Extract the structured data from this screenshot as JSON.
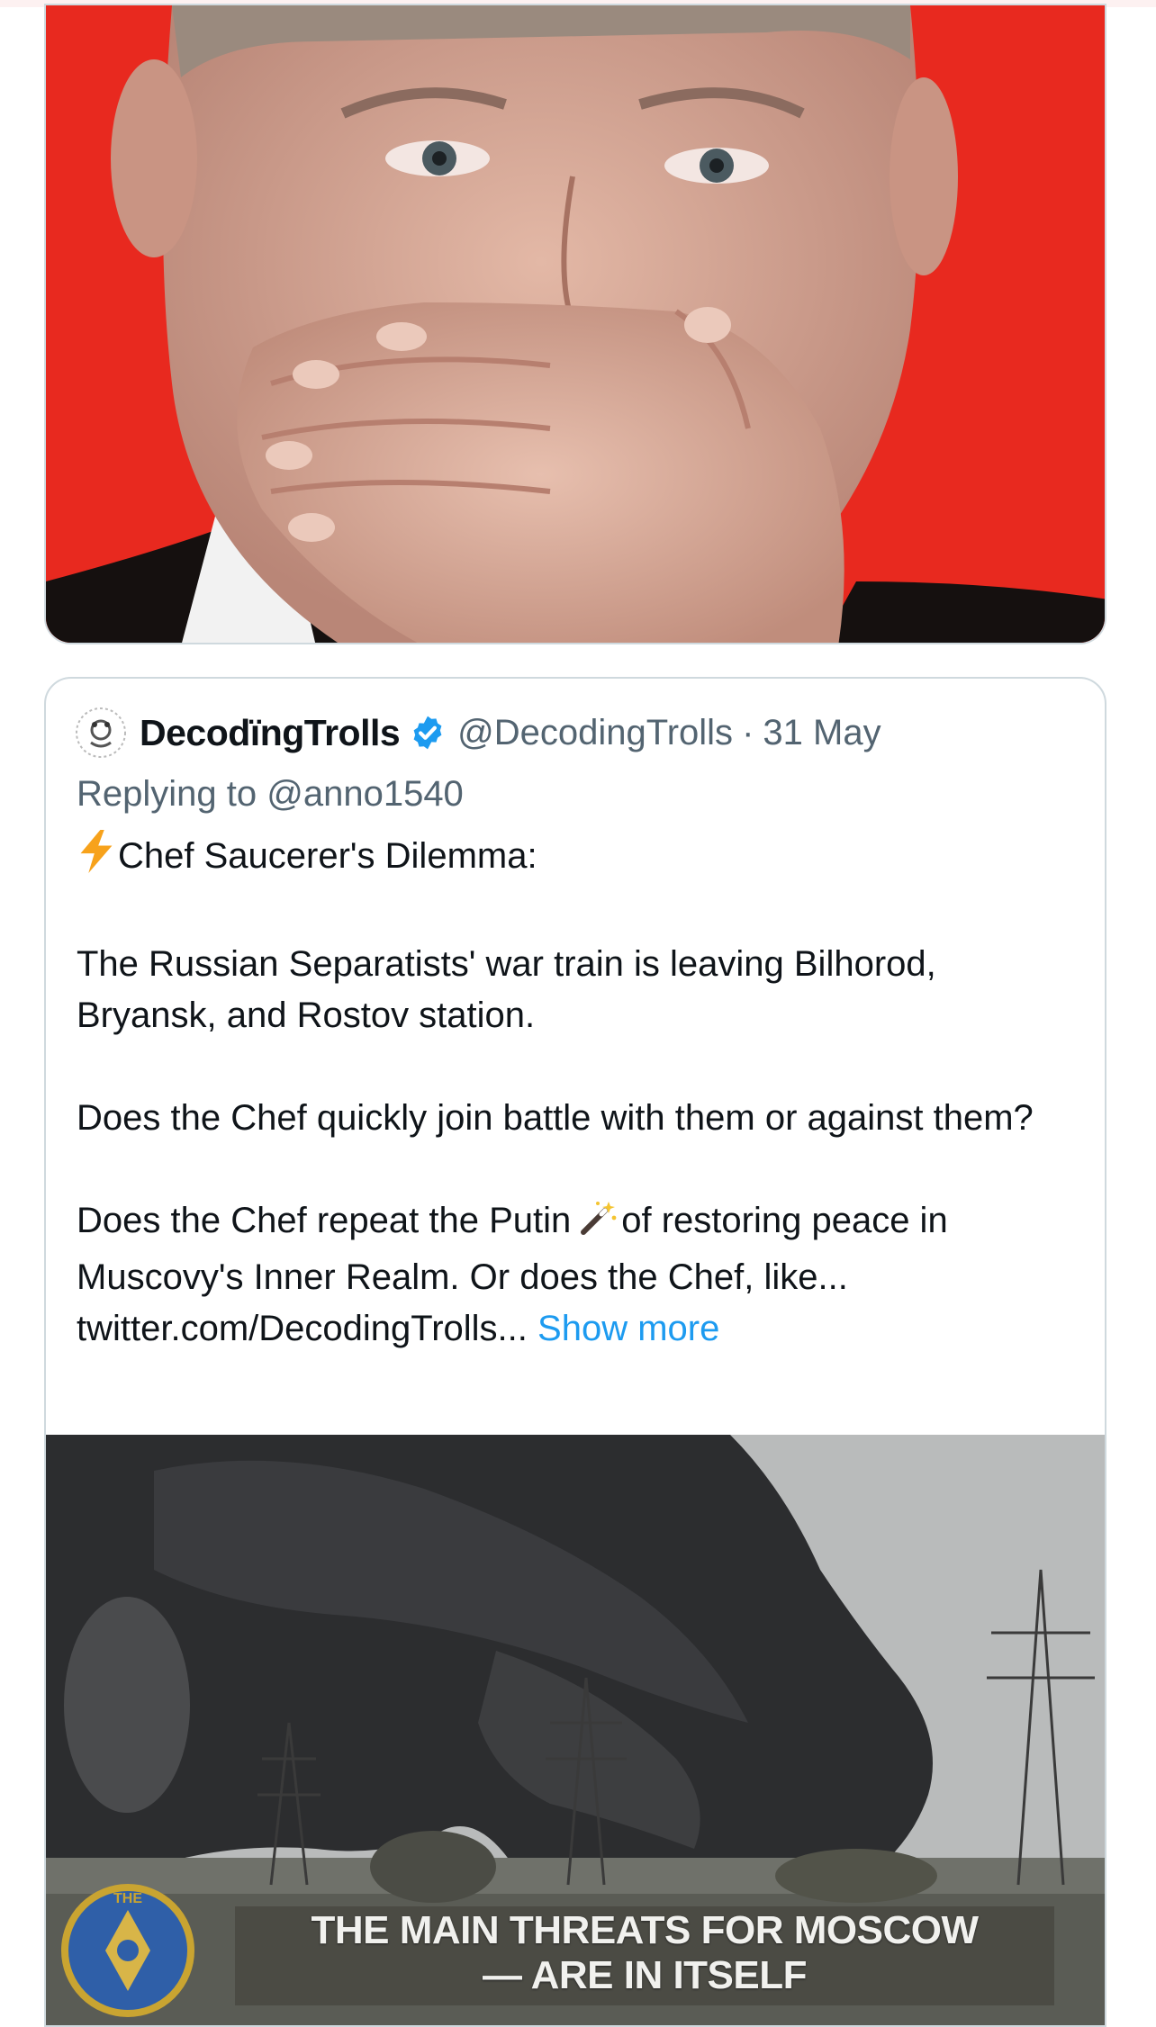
{
  "quoted_tweet": {
    "display_name": "DecodïngTrolls",
    "handle": "@DecodingTrolls",
    "separator": "·",
    "date": "31 May",
    "replying_to": "Replying to @anno1540",
    "body": {
      "line1": "Chef Saucerer's Dilemma:",
      "para2": "The Russian Separatists' war train is leaving Bilhorod, Bryansk, and Rostov station.",
      "para3": "Does the Chef quickly join battle with them or against them?",
      "para4_start": "Does the Chef repeat the Putin",
      "para4_end": "of restoring peace in Muscovy's Inner Realm. Or does the Chef, like...",
      "link": "twitter.com/DecodingTrolls...",
      "show_more": "Show more"
    },
    "media_caption": {
      "line1": "THE MAIN THREATS FOR MOSCOW",
      "line2": "— ARE IN ITSELF"
    },
    "emblem_text": "THE"
  },
  "icons": {
    "verified": "verified-badge-icon",
    "bolt": "high-voltage-emoji-icon",
    "wand": "magic-wand-emoji-icon",
    "avatar": "avatar-icon"
  },
  "colors": {
    "accent": "#1d9bf0",
    "text_primary": "#0f1419",
    "text_secondary": "#536471",
    "border": "#cfd9de",
    "photo_background_red": "#e8291f"
  }
}
